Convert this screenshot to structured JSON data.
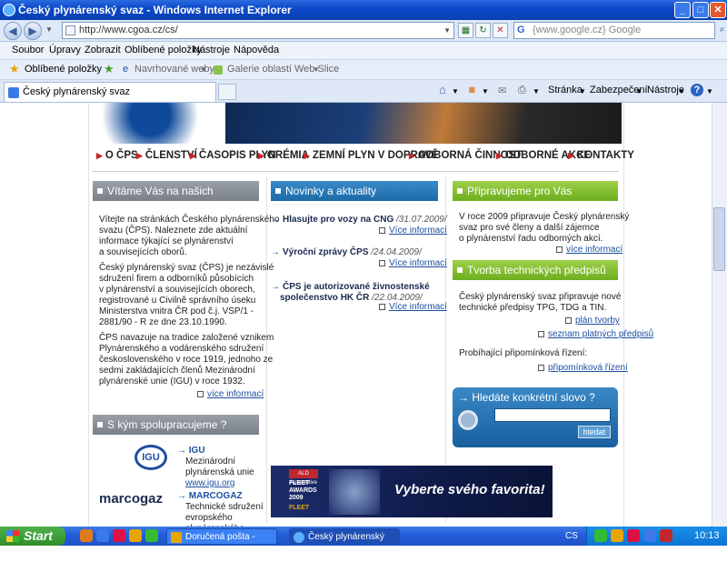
{
  "window": {
    "title": "Český plynárenský svaz - Windows Internet Explorer"
  },
  "address": {
    "url": "http://www.cgoa.cz/cs/",
    "search_placeholder": "{www.google.cz} Google"
  },
  "menu": [
    "Soubor",
    "Úpravy",
    "Zobrazit",
    "Oblíbené položky",
    "Nástroje",
    "Nápověda"
  ],
  "favorites": {
    "label": "Oblíbené položky",
    "suggested": "Navrhované weby",
    "gallery": "Galerie oblastí Web Slice"
  },
  "tab": {
    "title": "Český plynárenský svaz"
  },
  "tools": {
    "page": "Stránka",
    "security": "Zabezpečení",
    "tools": "Nástroje"
  },
  "site": {
    "nav": [
      "O ČPS",
      "ČLENSTVÍ",
      "ČASOPIS PLYN",
      "GRÉMIA",
      "ZEMNÍ PLYN V DOPRAVĚ",
      "ODBORNÁ ČINNOST",
      "ODBORNÉ AKCE",
      "KONTAKTY"
    ],
    "welcome": {
      "title": "Vítáme Vás na našich stránkách",
      "p1": [
        "Vítejte na stránkách Českého plynárenského",
        "svazu (ČPS). Naleznete zde aktuální",
        "informace týkající se plynárenství",
        "a souvisejících oborů."
      ],
      "p2": [
        "Český plynárenský svaz (ČPS) je nezávislé",
        "sdružení firem a odborníků působících",
        "v plynárenství a souvisejících oborech,",
        "registrované u Civilně správního úseku",
        "Ministerstva vnitra ČR pod č.j. VSP/1 -",
        "2881/90 - R ze dne 23.10.1990."
      ],
      "p3": [
        "ČPS navazuje na tradice založené vznikem",
        "Plynárenského a vodárenského sdružení",
        "československého v roce 1919, jednoho ze",
        "sedmi zakládajících členů Mezinárodní",
        "plynárenské unie (IGU) v roce 1932."
      ],
      "more": "více informací"
    },
    "partners": {
      "title": "S kým spolupracujeme ?",
      "igu": {
        "name": "IGU",
        "desc1": "Mezinárodní",
        "desc2": "plynárenská unie",
        "url": "www.igu.org",
        "logo": "IGU"
      },
      "marcogaz": {
        "name": "MARCOGAZ",
        "desc1": "Technické sdružení",
        "desc2": "evropského",
        "desc3": "plynárenského",
        "logo": "marcogaz"
      }
    },
    "news": {
      "title": "Novinky a aktuality",
      "items": [
        {
          "l1": "Hlasujte pro vozy na CNG",
          "date": "/31.07.2009/",
          "more": "Více informací"
        },
        {
          "l1": "Výroční zprávy ČPS",
          "date": "/24.04.2009/",
          "more": "Více informací"
        },
        {
          "l1": "ČPS je autorizované živnostenské",
          "l2": "společenstvo HK ČR",
          "date": "/22.04.2009/",
          "more": "Více informací"
        }
      ]
    },
    "prep": {
      "title": "Připravujeme pro Vás",
      "text": [
        "V roce 2009 připravuje Český plynárenský",
        "svaz pro své členy a další zájemce",
        "o plynárenství řadu odborných akcí."
      ],
      "more": "více informací"
    },
    "tech": {
      "title": "Tvorba technických předpisů",
      "text": [
        "Český plynárenský svaz připravuje nové",
        "technické předpisy TPG, TDG a TIN."
      ],
      "plan": "plán tvorby",
      "list": "seznam platných předpisů",
      "probiha": "Probíhající připomínková řízení:",
      "rizeni": "připomínková řízení"
    },
    "searchbox": {
      "title": "Hledáte konkrétní slovo ?",
      "button": "hledat"
    },
    "fleet": {
      "slogan": "Vyberte svého favorita!",
      "brand": "ALD Automotive",
      "award": "FLEET AWARDS 2009",
      "logo": "FLEET"
    }
  },
  "taskbar": {
    "start": "Start",
    "tasks": [
      "Doručená pošta - Mic...",
      "Český plynárenský sv..."
    ],
    "lang": "CS",
    "clock": "10:13"
  }
}
